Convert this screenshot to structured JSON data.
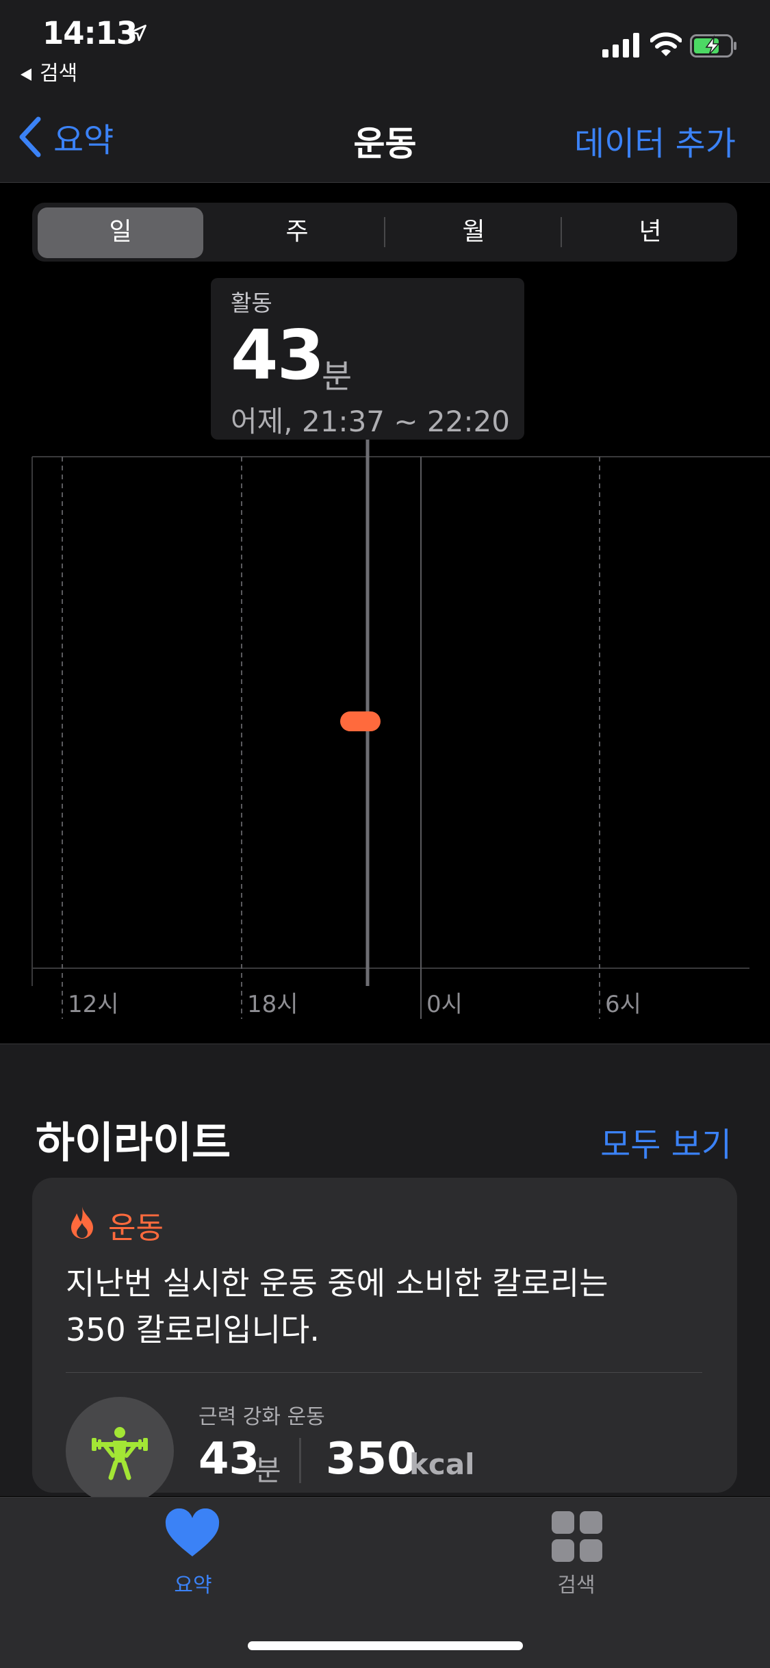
{
  "status": {
    "time": "14:13",
    "back_app": "검색"
  },
  "nav": {
    "back": "요약",
    "title": "운동",
    "action": "데이터 추가"
  },
  "segments": [
    "일",
    "주",
    "월",
    "년"
  ],
  "selected_segment": "일",
  "tooltip": {
    "label": "활동",
    "value": "43",
    "unit": "분",
    "range": "어제, 21:37 ~ 22:20"
  },
  "chart_data": {
    "type": "scatter",
    "x_tick_labels": [
      "12시",
      "18시",
      "0시",
      "6시"
    ],
    "points": [
      {
        "label": "어제, 21:37 ~ 22:20",
        "minutes": 43
      }
    ],
    "color": "#ff6a3d"
  },
  "highlights": {
    "title": "하이라이트",
    "see_all": "모두 보기",
    "card": {
      "category": "운동",
      "text": "지난번 실시한 운동 중에 소비한 칼로리는 350 칼로리입니다.",
      "workout_type": "근력 강화 운동",
      "minutes": "43",
      "minutes_unit": "분",
      "calories": "350",
      "calories_unit": "kcal"
    }
  },
  "tabs": [
    {
      "label": "요약",
      "icon": "heart-icon",
      "active": true
    },
    {
      "label": "검색",
      "icon": "grid-icon",
      "active": false
    }
  ],
  "colors": {
    "accent": "#3b82f6",
    "activity": "#ff6a3d",
    "exercise_green": "#a3e635"
  }
}
